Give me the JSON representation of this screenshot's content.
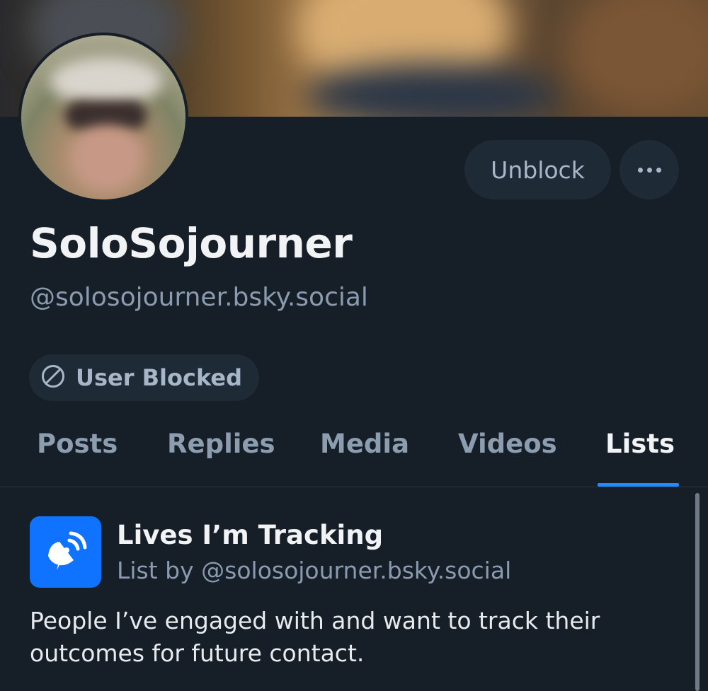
{
  "profile": {
    "display_name": "SoloSojourner",
    "handle": "@solosojourner.bsky.social",
    "blocked_label": "User Blocked"
  },
  "actions": {
    "unblock_label": "Unblock"
  },
  "tabs": [
    {
      "label": "Posts",
      "active": false
    },
    {
      "label": "Replies",
      "active": false
    },
    {
      "label": "Media",
      "active": false
    },
    {
      "label": "Videos",
      "active": false
    },
    {
      "label": "Lists",
      "active": true
    }
  ],
  "list_item": {
    "title": "Lives I’m Tracking",
    "byline": "List by @solosojourner.bsky.social",
    "description": "People I’ve engaged with and want to track their outcomes for future contact.",
    "icon": "satellite-dish-icon"
  },
  "colors": {
    "background": "#161e27",
    "accent": "#208bfe",
    "list_icon_bg": "#0f73ff",
    "pill_bg": "#1e2a36"
  }
}
